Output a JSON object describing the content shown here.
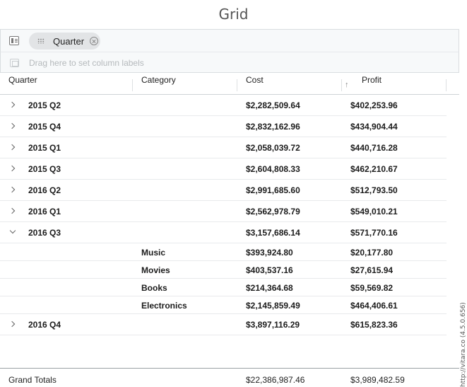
{
  "title": "Grid",
  "grouping": {
    "chip_label": "Quarter",
    "pivot_placeholder": "Drag here to set column labels"
  },
  "columns": {
    "quarter": "Quarter",
    "category": "Category",
    "cost": "Cost",
    "profit": "Profit",
    "sort_icon": "arrow-up-icon"
  },
  "rows": [
    {
      "quarter": "2015 Q2",
      "cost": "$2,282,509.64",
      "profit": "$402,253.96",
      "expanded": false
    },
    {
      "quarter": "2015 Q4",
      "cost": "$2,832,162.96",
      "profit": "$434,904.44",
      "expanded": false
    },
    {
      "quarter": "2015 Q1",
      "cost": "$2,058,039.72",
      "profit": "$440,716.28",
      "expanded": false
    },
    {
      "quarter": "2015 Q3",
      "cost": "$2,604,808.33",
      "profit": "$462,210.67",
      "expanded": false
    },
    {
      "quarter": "2016 Q2",
      "cost": "$2,991,685.60",
      "profit": "$512,793.50",
      "expanded": false
    },
    {
      "quarter": "2016 Q1",
      "cost": "$2,562,978.79",
      "profit": "$549,010.21",
      "expanded": false
    },
    {
      "quarter": "2016 Q3",
      "cost": "$3,157,686.14",
      "profit": "$571,770.16",
      "expanded": true,
      "children": [
        {
          "category": "Music",
          "cost": "$393,924.80",
          "profit": "$20,177.80"
        },
        {
          "category": "Movies",
          "cost": "$403,537.16",
          "profit": "$27,615.94"
        },
        {
          "category": "Books",
          "cost": "$214,364.68",
          "profit": "$59,569.82"
        },
        {
          "category": "Electronics",
          "cost": "$2,145,859.49",
          "profit": "$464,406.61"
        }
      ]
    },
    {
      "quarter": "2016 Q4",
      "cost": "$3,897,116.29",
      "profit": "$615,823.36",
      "expanded": false
    }
  ],
  "footer": {
    "label": "Grand Totals",
    "cost": "$22,386,987.46",
    "profit": "$3,989,482.59"
  },
  "watermark": "http://vitara.co (4.5.0.656)"
}
